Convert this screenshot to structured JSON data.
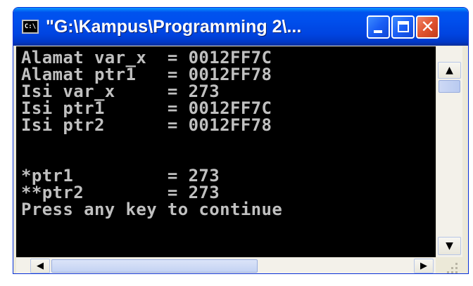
{
  "window": {
    "title": "\"G:\\Kampus\\Programming 2\\...",
    "system_icon_label": "C:\\",
    "minimize_icon": "minimize-icon",
    "maximize_icon": "maximize-icon",
    "close_icon": "close-icon",
    "close_glyph": "✕"
  },
  "console": {
    "lines": [
      "Alamat var_x  = 0012FF7C",
      "Alamat ptr1   = 0012FF78",
      "Isi var_x     = 273",
      "Isi ptr1      = 0012FF7C",
      "Isi ptr2      = 0012FF78",
      "",
      "*ptr1         = 273",
      "**ptr2        = 273",
      "Press any key to continue"
    ]
  },
  "scrollbars": {
    "up_arrow": "▲",
    "down_arrow": "▼",
    "left_arrow": "◀",
    "right_arrow": "▶"
  },
  "colors": {
    "titlebar": "#0053ee",
    "console_bg": "#000000",
    "console_text": "#c0c0c0",
    "close_button": "#e0532f"
  }
}
